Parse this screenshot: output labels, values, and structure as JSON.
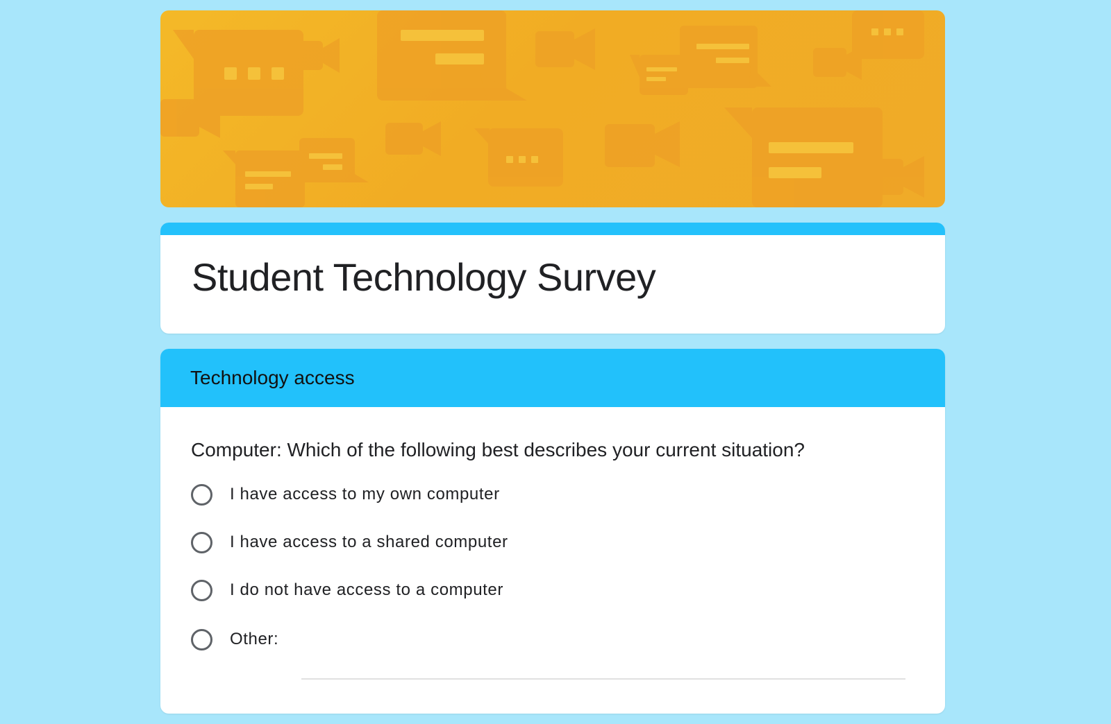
{
  "colors": {
    "page_background": "#a8e6fb",
    "theme_accent": "#22c1fb",
    "banner_base": "#f4b928",
    "banner_shapes": "#eea126"
  },
  "banner": {
    "icon": "chat-and-video-pattern-banner"
  },
  "form": {
    "title": "Student Technology Survey"
  },
  "section": {
    "title": "Technology access"
  },
  "question": {
    "text": "Computer: Which of the following best describes your current situation?",
    "type": "multiple-choice",
    "options": [
      "I have access to my own computer",
      "I have access to a shared computer",
      "I do not have access to a computer",
      "Other:"
    ],
    "other_value": ""
  }
}
